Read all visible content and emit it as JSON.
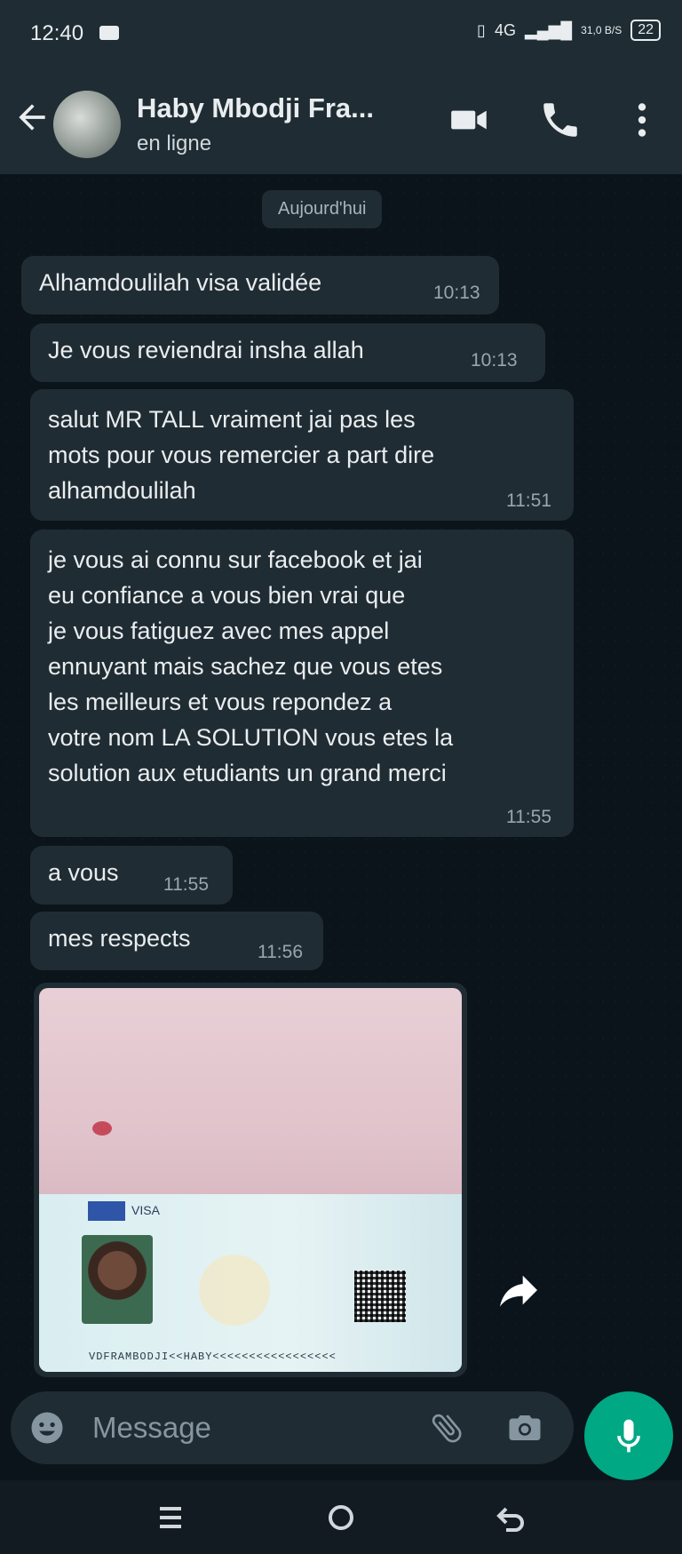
{
  "status_bar": {
    "time": "12:40",
    "network": "4G",
    "speed": "31,0 B/S",
    "battery": "22"
  },
  "header": {
    "contact_name": "Haby Mbodji Fra...",
    "status": "en ligne"
  },
  "chat": {
    "day_chip": "Aujourd'hui",
    "messages": [
      {
        "text": "Alhamdoulilah visa validée",
        "time": "10:13"
      },
      {
        "text": "Je vous reviendrai insha allah",
        "time": "10:13"
      },
      {
        "text": "salut MR TALL vraiment jai pas les\nmots pour vous remercier a part dire\nalhamdoulilah",
        "time": "11:51"
      },
      {
        "text": "je vous ai connu sur facebook et jai\neu confiance a vous bien vrai que\nje vous fatiguez avec mes appel\nennuyant mais sachez que vous etes\nles meilleurs et vous repondez a\nvotre nom LA SOLUTION vous etes la\nsolution aux etudiants un grand merci",
        "time": "11:55"
      },
      {
        "text": "a vous",
        "time": "11:55"
      },
      {
        "text": "mes respects",
        "time": "11:56"
      }
    ],
    "image_caption_visible": {
      "visa_label": "VISA",
      "mrz_line": "VDFRAMBODJI<<HABY<<<<<<<<<<<<<<<<<"
    }
  },
  "composer": {
    "placeholder": "Message"
  },
  "colors": {
    "chat_bg": "#0b141a",
    "bar_bg": "#1f2c34",
    "incoming_bubble": "#202c33",
    "accent": "#00a884"
  },
  "icons": [
    "back-arrow-icon",
    "video-call-icon",
    "voice-call-icon",
    "more-options-icon",
    "forward-icon",
    "emoji-icon",
    "attach-icon",
    "camera-icon",
    "mic-icon",
    "menu-icon",
    "home-icon",
    "back-nav-icon"
  ]
}
